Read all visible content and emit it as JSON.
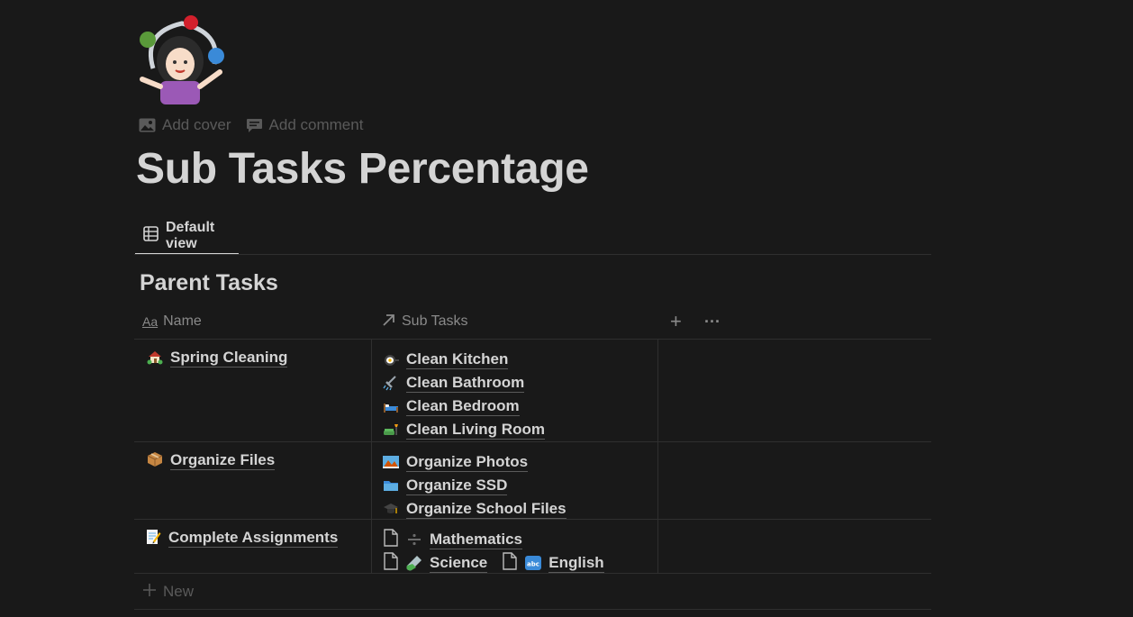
{
  "page": {
    "icon": "woman-juggling-emoji",
    "title": "Sub Tasks Percentage",
    "actions": {
      "add_cover": "Add cover",
      "add_comment": "Add comment"
    }
  },
  "view": {
    "tab_label": "Default view",
    "tab_icon": "table-icon"
  },
  "database": {
    "title": "Parent Tasks",
    "columns": {
      "name": "Name",
      "sub_tasks": "Sub Tasks",
      "add": "+",
      "more": "···"
    },
    "rows": [
      {
        "name": "Spring Cleaning",
        "icon": "house-garden-emoji",
        "sub_tasks": [
          {
            "label": "Clean Kitchen",
            "icon": "cooking-emoji"
          },
          {
            "label": "Clean Bathroom",
            "icon": "shower-emoji"
          },
          {
            "label": "Clean Bedroom",
            "icon": "bed-emoji"
          },
          {
            "label": "Clean Living Room",
            "icon": "couch-lamp-emoji"
          }
        ]
      },
      {
        "name": "Organize Files",
        "icon": "package-emoji",
        "sub_tasks": [
          {
            "label": "Organize Photos",
            "icon": "photo-landscape-emoji"
          },
          {
            "label": "Organize SSD",
            "icon": "folder-emoji"
          },
          {
            "label": "Organize School Files",
            "icon": "graduation-cap-emoji"
          }
        ]
      },
      {
        "name": "Complete Assignments",
        "icon": "memo-emoji",
        "sub_tasks": [
          {
            "label": "Mathematics",
            "icon": "divide-emoji"
          },
          {
            "label": "Science",
            "icon": "test-tube-emoji"
          },
          {
            "label": "English",
            "icon": "abc-emoji"
          }
        ]
      }
    ],
    "new_label": "New"
  }
}
